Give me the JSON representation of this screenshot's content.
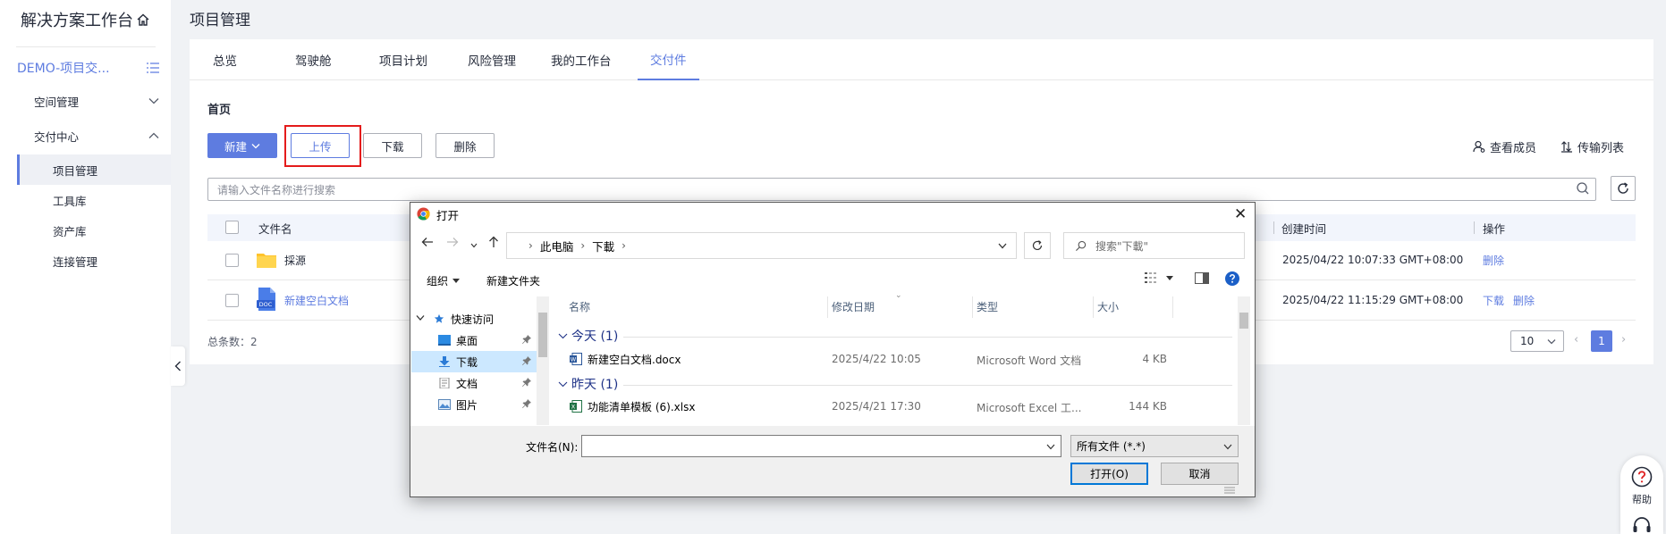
{
  "sidebar": {
    "title": "解决方案工作台",
    "project": "DEMO-项目交...",
    "groups": [
      {
        "label": "空间管理"
      },
      {
        "label": "交付中心"
      }
    ],
    "items": [
      {
        "label": "项目管理",
        "active": true
      },
      {
        "label": "工具库"
      },
      {
        "label": "资产库"
      },
      {
        "label": "连接管理"
      }
    ]
  },
  "header": {
    "title": "项目管理"
  },
  "tabs": [
    {
      "label": "总览"
    },
    {
      "label": "驾驶舱"
    },
    {
      "label": "项目计划"
    },
    {
      "label": "风险管理"
    },
    {
      "label": "我的工作台"
    },
    {
      "label": "交付件",
      "active": true
    }
  ],
  "breadcrumb": "首页",
  "toolbar": {
    "new": "新建",
    "upload": "上传",
    "download": "下载",
    "delete": "删除",
    "view_members": "查看成员",
    "transfer_list": "传输列表"
  },
  "search": {
    "placeholder": "请输入文件名称进行搜索"
  },
  "table": {
    "columns": {
      "name": "文件名",
      "created": "创建时间",
      "actions": "操作"
    },
    "rows": [
      {
        "name": "採源",
        "created": "2025/04/22 10:07:33 GMT+08:00",
        "actions": [
          "删除"
        ]
      },
      {
        "name": "新建空白文档",
        "created": "2025/04/22 11:15:29 GMT+08:00",
        "actions": [
          "下载",
          "删除"
        ]
      }
    ],
    "total": "总条数：2"
  },
  "pagination": {
    "size": "10",
    "current": "1"
  },
  "help": {
    "label": "帮助"
  },
  "dialog": {
    "title": "打开",
    "path": [
      "此电脑",
      "下載"
    ],
    "search_placeholder": "搜索\"下載\"",
    "organize": "组织",
    "new_folder": "新建文件夹",
    "nav": [
      {
        "label": "快速访问"
      },
      {
        "label": "桌面"
      },
      {
        "label": "下载",
        "active": true
      },
      {
        "label": "文档"
      },
      {
        "label": "图片"
      }
    ],
    "columns": {
      "name": "名称",
      "modified": "修改日期",
      "type": "类型",
      "size": "大小"
    },
    "groups": [
      {
        "label": "今天 (1)",
        "files": [
          {
            "name": "新建空白文档.docx",
            "modified": "2025/4/22 10:05",
            "type": "Microsoft Word 文档",
            "size": "4 KB"
          }
        ]
      },
      {
        "label": "昨天 (1)",
        "files": [
          {
            "name": "功能清单模板 (6).xlsx",
            "modified": "2025/4/21 17:30",
            "type": "Microsoft Excel 工...",
            "size": "144 KB"
          }
        ]
      }
    ],
    "filename_label": "文件名(N):",
    "filetype": "所有文件 (*.*)",
    "open": "打开(O)",
    "cancel": "取消"
  },
  "colors": {
    "accent": "#5e7ce0",
    "highlight": "#e41b1b"
  }
}
